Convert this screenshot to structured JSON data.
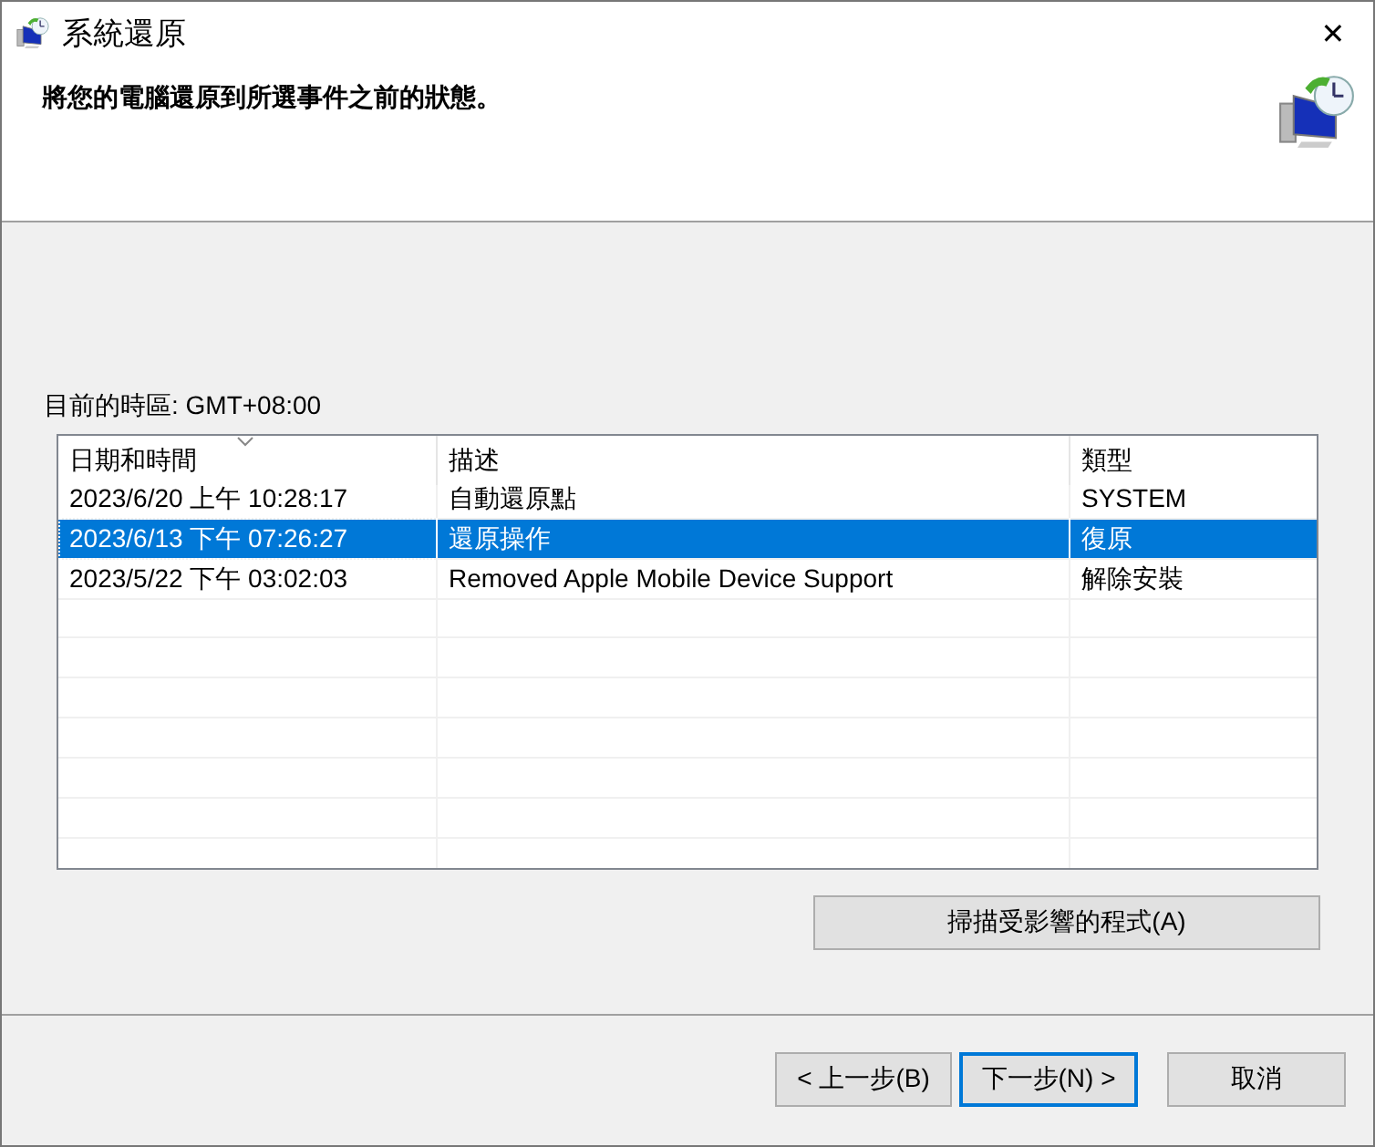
{
  "window": {
    "title": "系統還原",
    "close": "✕"
  },
  "header": {
    "instruction": "將您的電腦還原到所選事件之前的狀態。"
  },
  "timezone": "目前的時區: GMT+08:00",
  "table": {
    "columns": [
      {
        "label": "日期和時間",
        "sorted": true
      },
      {
        "label": "描述",
        "sorted": false
      },
      {
        "label": "類型",
        "sorted": false
      }
    ],
    "rows": [
      {
        "cells": [
          "2023/6/20 上午 10:28:17",
          "自動還原點",
          "SYSTEM"
        ],
        "selected": false
      },
      {
        "cells": [
          "2023/6/13 下午 07:26:27",
          "還原操作",
          "復原"
        ],
        "selected": true
      },
      {
        "cells": [
          "2023/5/22 下午 03:02:03",
          "Removed Apple Mobile Device Support",
          "解除安裝"
        ],
        "selected": false
      }
    ]
  },
  "scan_button": "掃描受影響的程式(A)",
  "buttons": [
    {
      "label": "< 上一步(B)",
      "default": false
    },
    {
      "label": "下一步(N) >",
      "default": true
    },
    {
      "label": "取消",
      "default": false
    }
  ]
}
